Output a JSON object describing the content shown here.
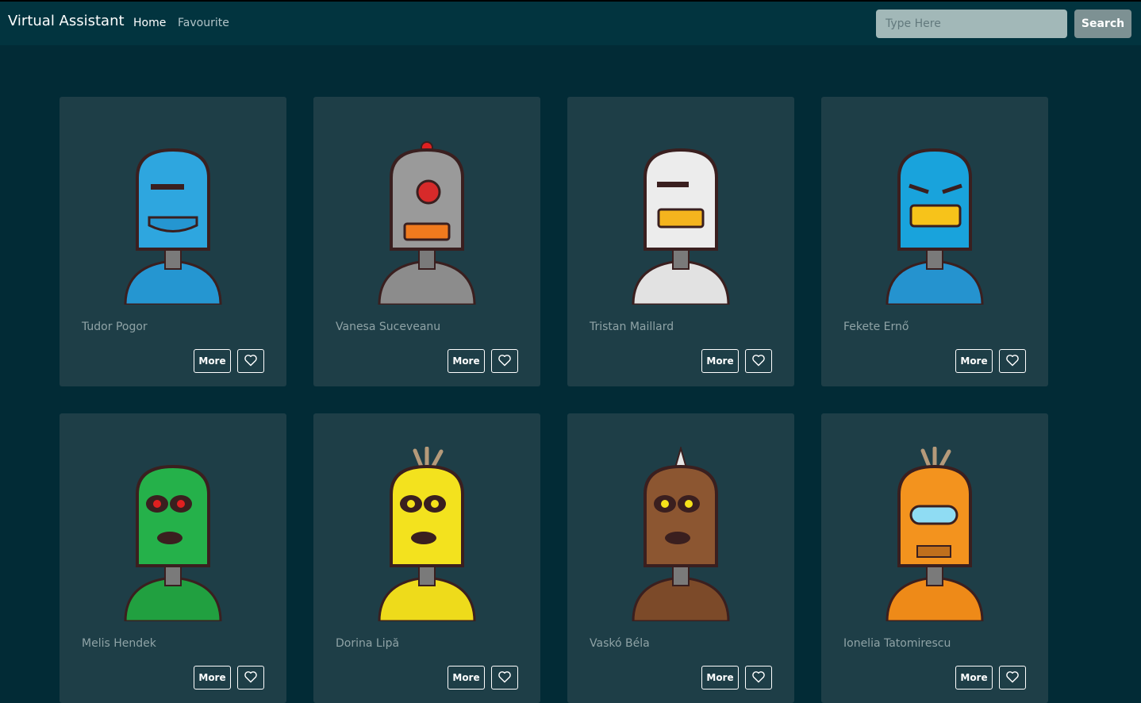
{
  "navbar": {
    "brand": "Virtual Assistant",
    "links": [
      {
        "label": "Home",
        "active": true
      },
      {
        "label": "Favourite",
        "active": false
      }
    ],
    "search": {
      "placeholder": "Type Here",
      "value": "",
      "button_label": "Search"
    }
  },
  "cards": [
    {
      "name": "Tudor Pogor",
      "more_label": "More",
      "favourite_icon": "heart-outline-icon",
      "robot": {
        "icon": "blue-robot-avatar",
        "head_color": "#2ea6df",
        "body_color": "#2596d1"
      }
    },
    {
      "name": "Vanesa Suceveanu",
      "more_label": "More",
      "favourite_icon": "heart-outline-icon",
      "robot": {
        "icon": "gray-robot-avatar",
        "head_color": "#9a9a9a",
        "body_color": "#8c8c8c"
      }
    },
    {
      "name": "Tristan Maillard",
      "more_label": "More",
      "favourite_icon": "heart-outline-icon",
      "robot": {
        "icon": "white-robot-avatar",
        "head_color": "#ececec",
        "body_color": "#e2e2e2"
      }
    },
    {
      "name": "Fekete Ernő",
      "more_label": "More",
      "favourite_icon": "heart-outline-icon",
      "robot": {
        "icon": "cyan-robot-avatar",
        "head_color": "#19a3dc",
        "body_color": "#2593cf"
      }
    },
    {
      "name": "Melis Hendek",
      "more_label": "More",
      "favourite_icon": "heart-outline-icon",
      "robot": {
        "icon": "green-robot-avatar",
        "head_color": "#25b14a",
        "body_color": "#21a040"
      }
    },
    {
      "name": "Dorina Lipă",
      "more_label": "More",
      "favourite_icon": "heart-outline-icon",
      "robot": {
        "icon": "yellow-robot-avatar",
        "head_color": "#f3e21e",
        "body_color": "#eedb1b"
      }
    },
    {
      "name": "Vaskó Béla",
      "more_label": "More",
      "favourite_icon": "heart-outline-icon",
      "robot": {
        "icon": "brown-robot-avatar",
        "head_color": "#8c5631",
        "body_color": "#7c4a29"
      }
    },
    {
      "name": "Ionelia Tatomirescu",
      "more_label": "More",
      "favourite_icon": "heart-outline-icon",
      "robot": {
        "icon": "orange-robot-avatar",
        "head_color": "#f3931e",
        "body_color": "#ee8a18"
      }
    }
  ]
}
